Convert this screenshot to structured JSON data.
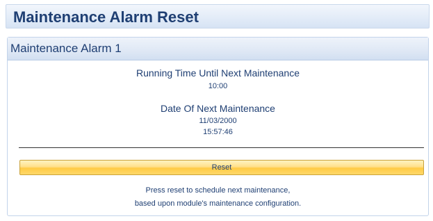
{
  "title": "Maintenance Alarm Reset",
  "panel": {
    "header": "Maintenance Alarm 1",
    "running_time_label": "Running Time Until Next Maintenance",
    "running_time_value": "10:00",
    "date_label": "Date Of Next Maintenance",
    "date_value": "11/03/2000",
    "time_value": "15:57:46",
    "reset_label": "Reset",
    "help_line1": "Press reset to schedule next maintenance,",
    "help_line2": "based upon module's maintenance configuration."
  }
}
